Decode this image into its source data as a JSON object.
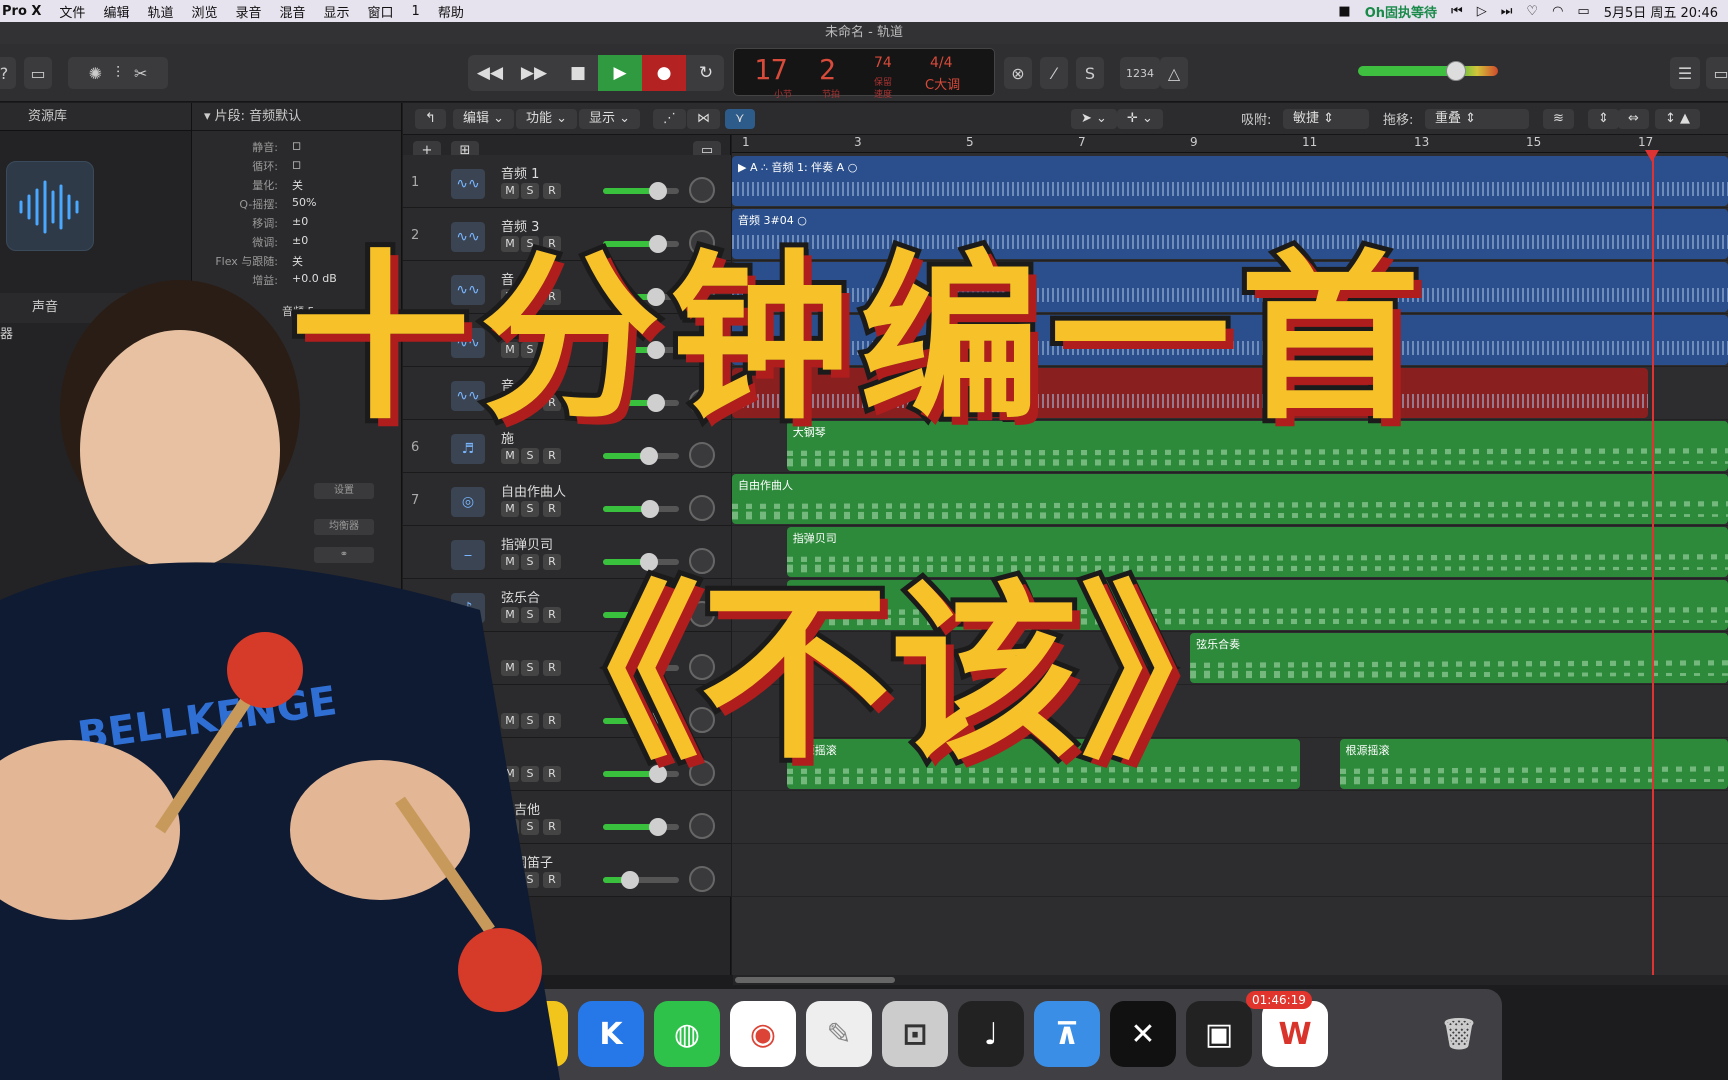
{
  "menubar": {
    "app": "Pro X",
    "items": [
      "文件",
      "编辑",
      "轨道",
      "浏览",
      "录音",
      "混音",
      "显示",
      "窗口",
      "1",
      "帮助"
    ],
    "now_playing": "Oh固执等待",
    "datetime": "5月5日 周五  20:46"
  },
  "window": {
    "title": "未命名 - 轨道"
  },
  "lcd": {
    "bar": "17",
    "beat": "2",
    "bar_label": "小节",
    "beat_label": "节拍",
    "tempo": "74",
    "tempo_label": "保留",
    "tempo_sub": "速度",
    "signature": "4/4",
    "key": "C大调"
  },
  "toolbar": {
    "counter": "1234"
  },
  "library": {
    "header": "资源库",
    "sound": "声音",
    "section": "器"
  },
  "inspector": {
    "header": "片段: 音频默认",
    "rows": [
      {
        "label": "静音:",
        "value": ""
      },
      {
        "label": "循环:",
        "value": ""
      },
      {
        "label": "量化:",
        "value": "关"
      },
      {
        "label": "Q-摇摆:",
        "value": "50%"
      },
      {
        "label": "移调:",
        "value": "±0"
      },
      {
        "label": "微调:",
        "value": "±0"
      },
      {
        "label": "Flex 与跟随:",
        "value": "关"
      },
      {
        "label": "增益:",
        "value": "+0.0 dB"
      }
    ],
    "track_label": "音频 5",
    "btn_settings": "设置",
    "btn_eq": "均衡器"
  },
  "arrange_toolbar": {
    "edit": "编辑",
    "functions": "功能",
    "view": "显示",
    "snap_label": "吸附:",
    "snap_value": "敏捷",
    "drag_label": "拖移:",
    "drag_value": "重叠"
  },
  "ruler": [
    "1",
    "3",
    "5",
    "7",
    "9",
    "11",
    "13",
    "15",
    "17"
  ],
  "tracks": [
    {
      "num": "1",
      "name": "音频 1",
      "icon": "waveform-icon",
      "fader": 0.72
    },
    {
      "num": "2",
      "name": "音频 3",
      "icon": "waveform-icon",
      "fader": 0.72
    },
    {
      "num": "",
      "name": "音",
      "icon": "waveform-icon",
      "fader": 0.7
    },
    {
      "num": "",
      "name": "",
      "icon": "waveform-icon",
      "fader": 0.7
    },
    {
      "num": "",
      "name": "音",
      "icon": "waveform-icon",
      "fader": 0.7
    },
    {
      "num": "6",
      "name": "施",
      "icon": "piano-icon",
      "fader": 0.6
    },
    {
      "num": "7",
      "name": "自由作曲人",
      "icon": "drums-icon",
      "fader": 0.62
    },
    {
      "num": "",
      "name": "指弹贝司",
      "icon": "bass-icon",
      "fader": 0.6
    },
    {
      "num": "",
      "name": "弦乐合",
      "icon": "strings-icon",
      "fader": 0.6
    },
    {
      "num": "",
      "name": "",
      "icon": "strings-icon",
      "fader": 0.6
    },
    {
      "num": "",
      "name": "",
      "icon": "instrument-icon",
      "fader": 0.6
    },
    {
      "num": "",
      "name": "",
      "icon": "instrument-icon",
      "fader": 0.72
    },
    {
      "num": "",
      "name": "木吉他",
      "icon": "music-note-icon",
      "fader": 0.72
    },
    {
      "num": "",
      "name": "中国笛子",
      "icon": "flute-icon",
      "fader": 0.35
    }
  ],
  "regions": [
    {
      "lane": 0,
      "type": "audio",
      "name": "▶ A ∴ 音频 1: 伴奏 A  ○",
      "start": 0.0,
      "end": 1.0
    },
    {
      "lane": 1,
      "type": "audio",
      "name": "音频 3#04  ○",
      "start": 0.0,
      "end": 1.0
    },
    {
      "lane": 2,
      "type": "audio",
      "name": "",
      "start": 0.0,
      "end": 1.0
    },
    {
      "lane": 3,
      "type": "audio",
      "name": "",
      "start": 0.0,
      "end": 1.0
    },
    {
      "lane": 4,
      "type": "red",
      "name": "",
      "start": 0.0,
      "end": 0.92
    },
    {
      "lane": 5,
      "type": "midi",
      "name": "大钢琴",
      "start": 0.055,
      "end": 1.0
    },
    {
      "lane": 6,
      "type": "midi",
      "name": "自由作曲人",
      "start": 0.0,
      "end": 1.0
    },
    {
      "lane": 7,
      "type": "midi",
      "name": "指弹贝司",
      "start": 0.055,
      "end": 1.0
    },
    {
      "lane": 8,
      "type": "midi",
      "name": "",
      "start": 0.055,
      "end": 1.0
    },
    {
      "lane": 9,
      "type": "midi",
      "name": "弦乐合奏",
      "start": 0.46,
      "end": 1.0
    },
    {
      "lane": 11,
      "type": "midi",
      "name": "根源摇滚",
      "start": 0.055,
      "end": 0.57
    },
    {
      "lane": 11,
      "type": "midi",
      "name": "根源摇滚",
      "start": 0.61,
      "end": 1.0
    }
  ],
  "overlay": {
    "title1": "十分钟编一首",
    "title2": "《不该》"
  },
  "dock": {
    "badge": "01:46:19"
  }
}
